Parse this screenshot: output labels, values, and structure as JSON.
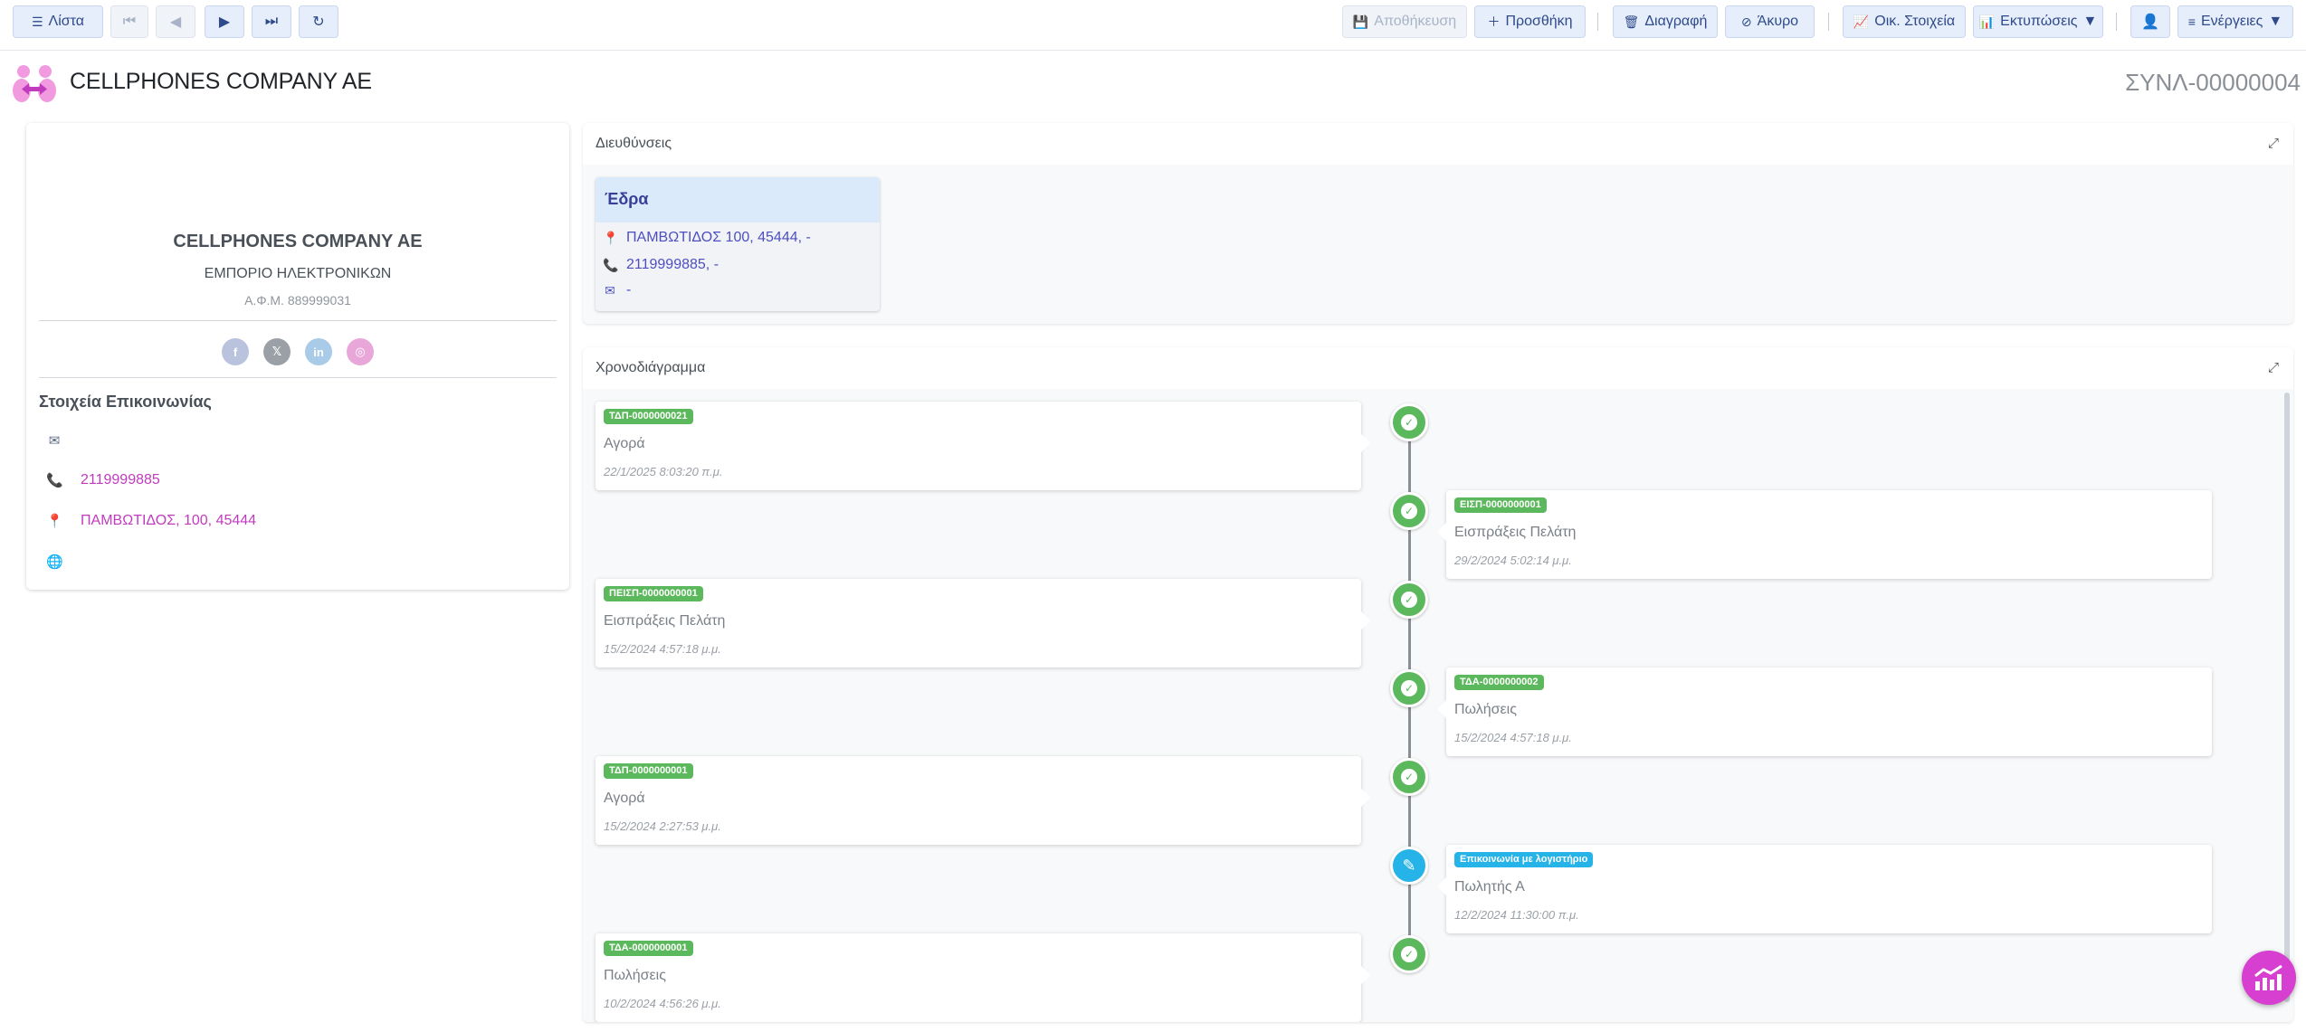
{
  "toolbar": {
    "list": "Λίστα",
    "save": "Αποθήκευση",
    "add": "Προσθήκη",
    "delete": "Διαγραφή",
    "cancel": "Άκυρο",
    "financial": "Οικ. Στοιχεία",
    "prints": "Εκτυπώσεις",
    "actions": "Ενέργειες"
  },
  "header": {
    "company": "CELLPHONES COMPANY AE",
    "code": "ΣΥΝΛ-00000004"
  },
  "profile": {
    "name": "CELLPHONES COMPANY AE",
    "activity": "ΕΜΠΟΡΙΟ ΗΛΕΚΤΡΟΝΙΚΩΝ",
    "vat": "Α.Φ.Μ. 889999031",
    "contact_title": "Στοιχεία Επικοινωνίας",
    "phone": "2119999885",
    "address": "ΠΑΜΒΩΤΙΔΟΣ, 100, 45444"
  },
  "addresses": {
    "title": "Διευθύνσεις",
    "card": {
      "label": "Έδρα",
      "address": "ΠΑΜΒΩΤΙΔΟΣ 100, 45444, -",
      "phone": "2119999885, -",
      "email": "-"
    }
  },
  "timeline": {
    "title": "Χρονοδιάγραμμα",
    "items": [
      {
        "badge": "ΤΔΠ-0000000021",
        "title": "Αγορά",
        "date": "22/1/2025 8:03:20 π.μ."
      },
      {
        "badge": "ΕΙΣΠ-0000000001",
        "title": "Εισπράξεις Πελάτη",
        "date": "29/2/2024 5:02:14 μ.μ."
      },
      {
        "badge": "ΠΕΙΣΠ-0000000001",
        "title": "Εισπράξεις Πελάτη",
        "date": "15/2/2024 4:57:18 μ.μ."
      },
      {
        "badge": "ΤΔΑ-0000000002",
        "title": "Πωλήσεις",
        "date": "15/2/2024 4:57:18 μ.μ."
      },
      {
        "badge": "ΤΔΠ-0000000001",
        "title": "Αγορά",
        "date": "15/2/2024 2:27:53 μ.μ."
      },
      {
        "badge": "Επικοινωνία με λογιστήριο",
        "title": "Πωλητής Α",
        "date": "12/2/2024 11:30:00 π.μ."
      },
      {
        "badge": "ΤΔΑ-0000000001",
        "title": "Πωλήσεις",
        "date": "10/2/2024 4:56:26 μ.μ."
      }
    ]
  },
  "colors": {
    "accent": "#c13bbf",
    "success": "#5cb85c",
    "info": "#26b3e8",
    "button_bg": "#e7eefb"
  }
}
